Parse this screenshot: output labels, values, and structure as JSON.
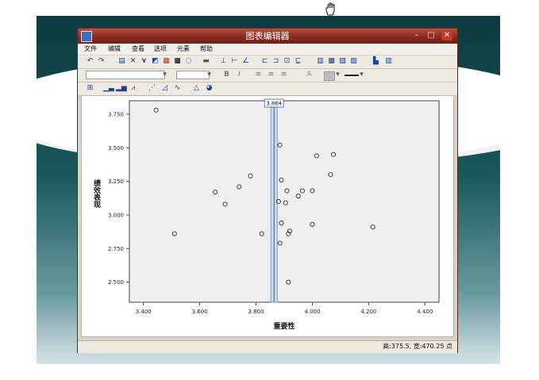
{
  "window": {
    "title": "图表编辑器",
    "controls": [
      "–",
      "□",
      "✕"
    ]
  },
  "menu": [
    "文件",
    "编辑",
    "查看",
    "选项",
    "元素",
    "帮助"
  ],
  "toolbar": {
    "text_controls": [
      "B",
      "I",
      "A"
    ]
  },
  "status": {
    "text": "高:375.5, 宽:470.25 点"
  },
  "chart_data": {
    "type": "scatter",
    "title": "",
    "xlabel": "重要性",
    "ylabel": "绩效表现",
    "xlim": [
      3.35,
      4.45
    ],
    "ylim": [
      2.35,
      3.85
    ],
    "x_ticks": [
      "3.400",
      "3.600",
      "3.800",
      "4.000",
      "4.200",
      "4.400"
    ],
    "x_tick_values": [
      3.4,
      3.6,
      3.8,
      4.0,
      4.2,
      4.4
    ],
    "y_ticks": [
      "3.750",
      "3.500",
      "3.250",
      "3.000",
      "2.750",
      "2.500"
    ],
    "y_tick_values": [
      3.75,
      3.5,
      3.25,
      3.0,
      2.75,
      2.5
    ],
    "reference_line": {
      "x": 3.864,
      "label": "3.864"
    },
    "grid": false,
    "points": [
      {
        "x": 3.445,
        "y": 3.78
      },
      {
        "x": 3.51,
        "y": 2.86
      },
      {
        "x": 3.655,
        "y": 3.17
      },
      {
        "x": 3.69,
        "y": 3.08
      },
      {
        "x": 3.74,
        "y": 3.21
      },
      {
        "x": 3.78,
        "y": 3.29
      },
      {
        "x": 3.82,
        "y": 2.86
      },
      {
        "x": 3.88,
        "y": 3.1
      },
      {
        "x": 3.885,
        "y": 3.52
      },
      {
        "x": 3.89,
        "y": 3.26
      },
      {
        "x": 3.89,
        "y": 2.94
      },
      {
        "x": 3.885,
        "y": 2.79
      },
      {
        "x": 3.91,
        "y": 3.18
      },
      {
        "x": 3.905,
        "y": 3.09
      },
      {
        "x": 3.915,
        "y": 2.86
      },
      {
        "x": 3.92,
        "y": 2.88
      },
      {
        "x": 3.915,
        "y": 2.5
      },
      {
        "x": 3.95,
        "y": 3.14
      },
      {
        "x": 3.965,
        "y": 3.18
      },
      {
        "x": 4.0,
        "y": 3.18
      },
      {
        "x": 4.0,
        "y": 2.93
      },
      {
        "x": 4.015,
        "y": 3.44
      },
      {
        "x": 4.065,
        "y": 3.3
      },
      {
        "x": 4.075,
        "y": 3.45
      },
      {
        "x": 4.215,
        "y": 2.91
      }
    ],
    "colors": {
      "background": "#efefef",
      "marker": "#333333",
      "refline": "#7aa0c8"
    }
  }
}
